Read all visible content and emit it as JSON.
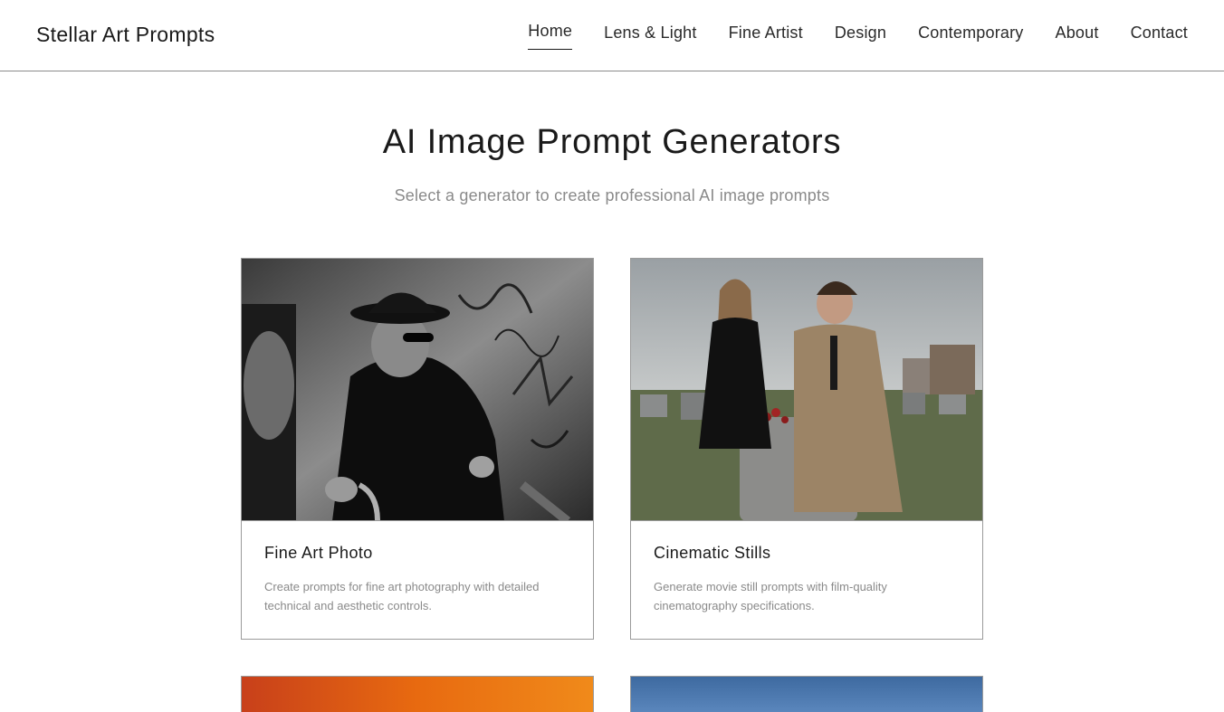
{
  "header": {
    "brand": "Stellar Art Prompts",
    "nav": [
      {
        "label": "Home",
        "active": true
      },
      {
        "label": "Lens & Light",
        "active": false
      },
      {
        "label": "Fine Artist",
        "active": false
      },
      {
        "label": "Design",
        "active": false
      },
      {
        "label": "Contemporary",
        "active": false
      },
      {
        "label": "About",
        "active": false
      },
      {
        "label": "Contact",
        "active": false
      }
    ]
  },
  "hero": {
    "title": "AI Image Prompt Generators",
    "subtitle": "Select a generator to create professional AI image prompts"
  },
  "cards": [
    {
      "title": "Fine Art Photo",
      "description": "Create prompts for fine art photography with detailed technical and aesthetic controls."
    },
    {
      "title": "Cinematic Stills",
      "description": "Generate movie still prompts with film-quality cinematography specifications."
    }
  ],
  "colors": {
    "text": "#1a1a1a",
    "muted": "#8a8a8a",
    "border": "#9a9a9a"
  }
}
